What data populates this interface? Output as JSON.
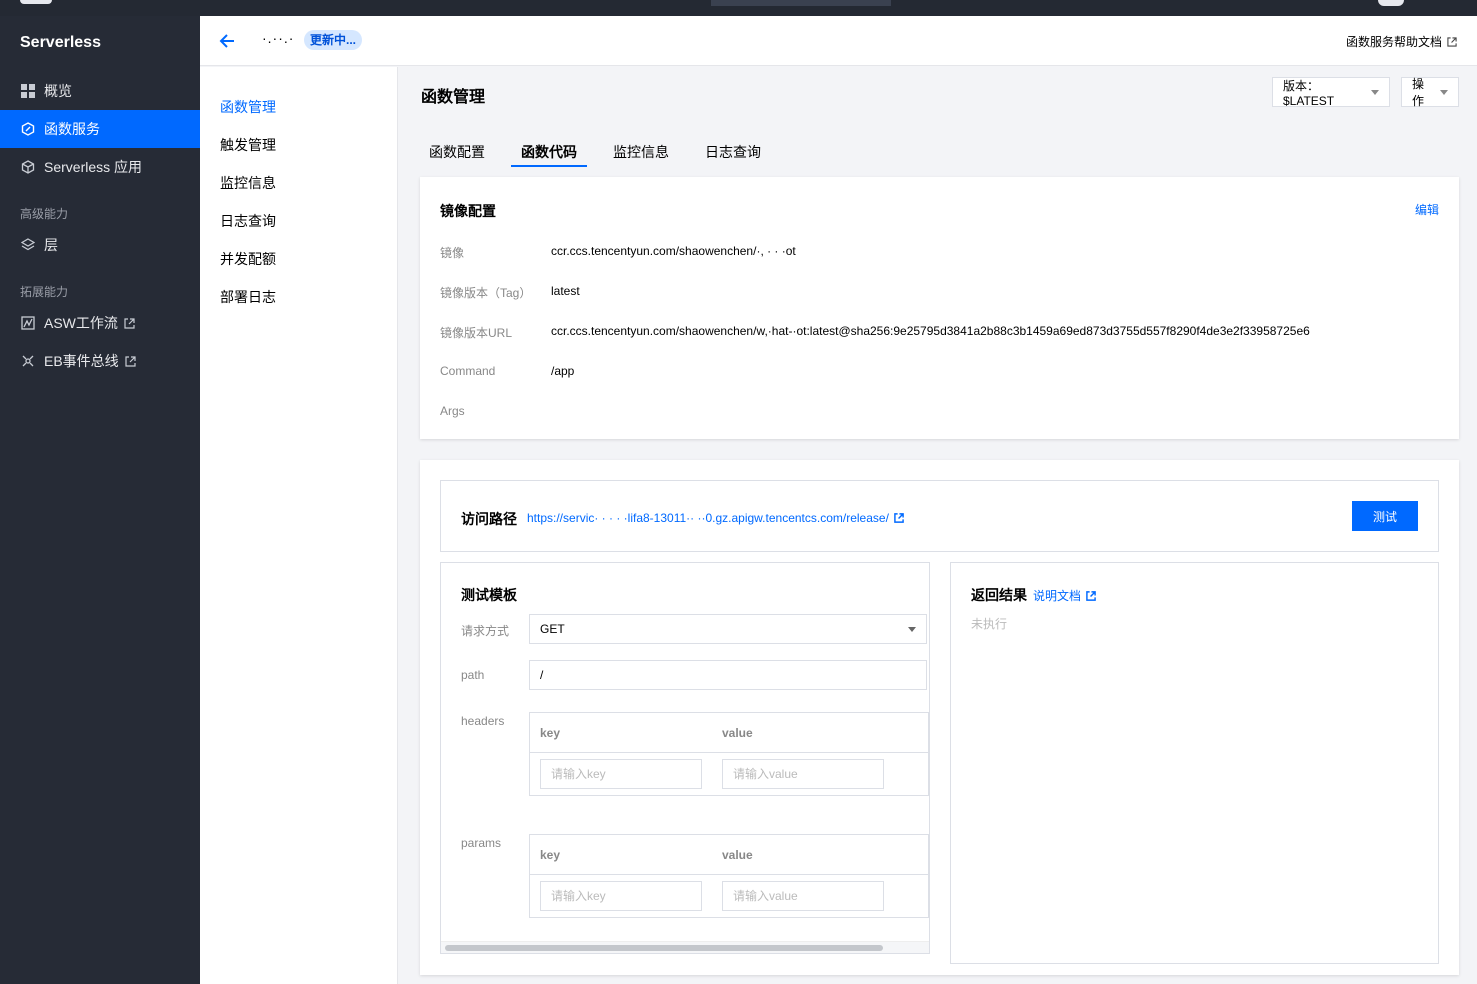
{
  "sidebar": {
    "brand": "Serverless",
    "items": [
      {
        "label": "概览",
        "icon": "grid-icon"
      },
      {
        "label": "函数服务",
        "icon": "function-icon"
      },
      {
        "label": "Serverless 应用",
        "icon": "cube-icon"
      }
    ],
    "section_advanced": "高级能力",
    "advanced_items": [
      {
        "label": "层",
        "icon": "layers-icon"
      }
    ],
    "section_extend": "拓展能力",
    "extend_items": [
      {
        "label": "ASW工作流",
        "icon": "workflow-icon"
      },
      {
        "label": "EB事件总线",
        "icon": "eventbus-icon"
      }
    ]
  },
  "header": {
    "function_name": "·.··.·",
    "status": "更新中...",
    "help_link": "函数服务帮助文档"
  },
  "subnav": {
    "items": [
      "函数管理",
      "触发管理",
      "监控信息",
      "日志查询",
      "并发配额",
      "部署日志"
    ]
  },
  "main": {
    "title": "函数管理",
    "version_label": "版本：$LATEST",
    "actions_label": "操作",
    "tabs": [
      "函数配置",
      "函数代码",
      "监控信息",
      "日志查询"
    ]
  },
  "image_config": {
    "title": "镜像配置",
    "edit": "编辑",
    "rows": [
      {
        "label": "镜像",
        "value": "ccr.ccs.tencentyun.com/shaowenchen/·, ·   · ·ot"
      },
      {
        "label": "镜像版本（Tag）",
        "value": "latest"
      },
      {
        "label": "镜像版本URL",
        "value": "ccr.ccs.tencentyun.com/shaowenchen/w,·hat-·ot:latest@sha256:9e25795d3841a2b88c3b1459a69ed873d3755d557f8290f4de3e2f33958725e6"
      },
      {
        "label": "Command",
        "value": "/app"
      },
      {
        "label": "Args",
        "value": ""
      }
    ]
  },
  "access": {
    "label": "访问路径",
    "url": "https://servic·  · · ·  ·lifa8-13011·· ··0.gz.apigw.tencentcs.com/release/",
    "test_button": "测试"
  },
  "test_template": {
    "title": "测试模板",
    "method_label": "请求方式",
    "method_value": "GET",
    "path_label": "path",
    "path_value": "/",
    "headers_label": "headers",
    "params_label": "params",
    "key_header": "key",
    "value_header": "value",
    "key_placeholder": "请输入key",
    "value_placeholder": "请输入value"
  },
  "result": {
    "title": "返回结果",
    "doc_link": "说明文档",
    "empty": "未执行"
  },
  "colors": {
    "accent": "#0069ff",
    "sidebar_bg": "#262b36",
    "badge_bg": "#d5e7ff"
  }
}
